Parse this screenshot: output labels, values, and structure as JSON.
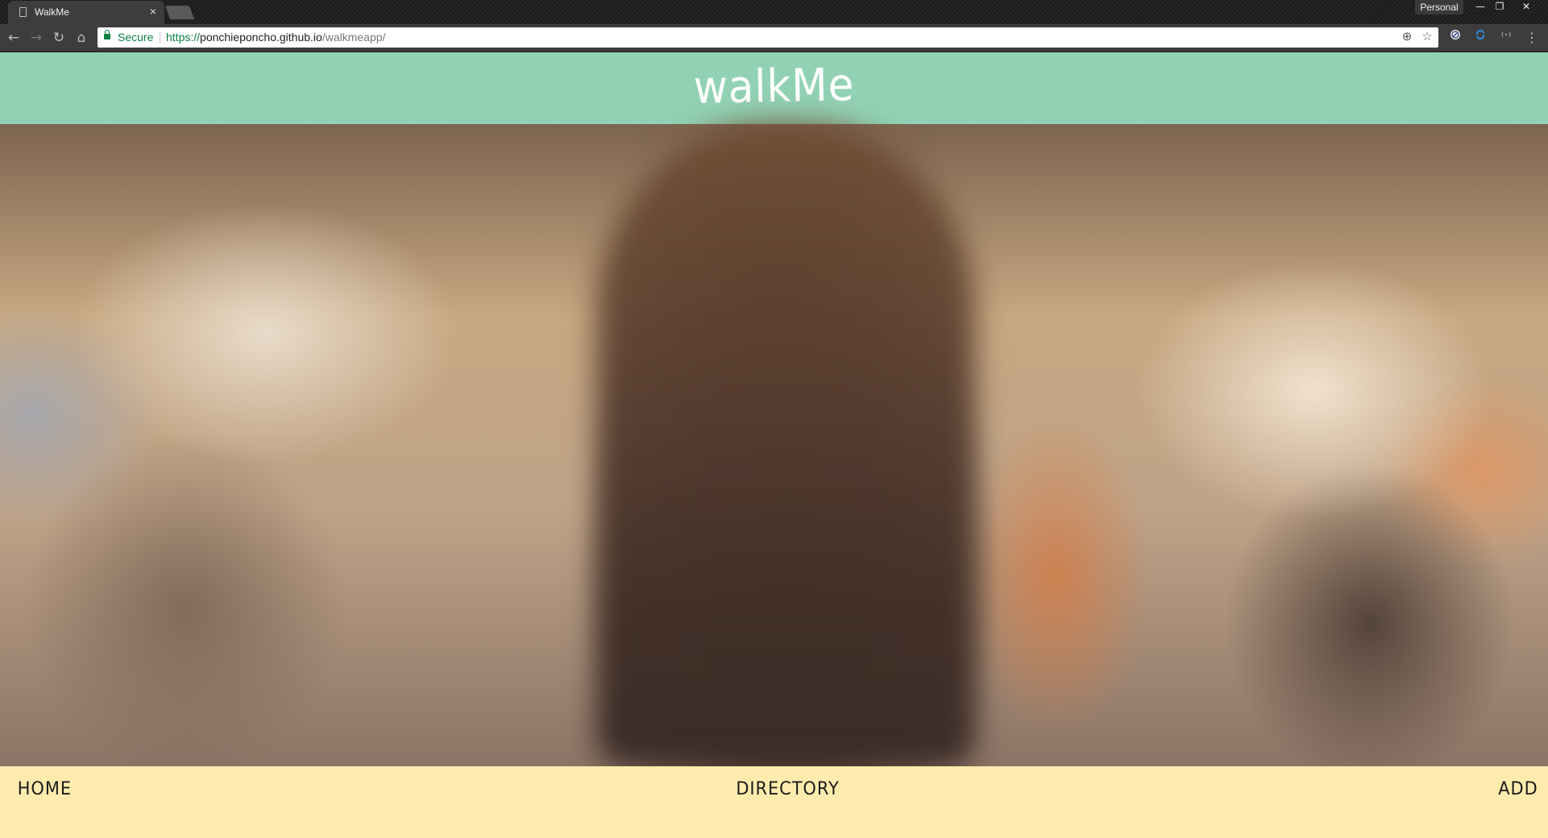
{
  "browser": {
    "tab_title": "WalkMe",
    "tab_close": "×",
    "profile_label": "Personal",
    "window_controls": {
      "minimize": "—",
      "restore": "❐",
      "close": "✕"
    },
    "nav": {
      "back": "←",
      "forward": "→",
      "reload": "↻",
      "home": "⌂"
    },
    "omnibox": {
      "secure_label": "Secure",
      "url_scheme": "https://",
      "url_host": "ponchieponcho.github.io",
      "url_path": "/walkmeapp/"
    },
    "icons": {
      "location": "⊕",
      "bookmark_star": "☆",
      "menu": "⋮"
    }
  },
  "site": {
    "logo": "walkMe",
    "header_color": "#92d2b4",
    "nav_bar_color": "#ffecad",
    "nav": {
      "home": "HOME",
      "directory": "DIRECTORY",
      "add": "ADD"
    }
  }
}
